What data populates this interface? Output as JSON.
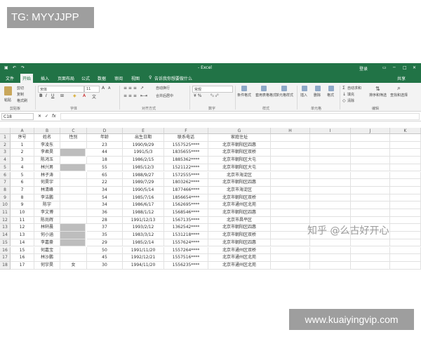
{
  "overlay": {
    "tag": "TG: MYYJJPP",
    "site": "www.kuaiyingvip.com"
  },
  "window": {
    "title": "- Excel",
    "login": "登录"
  },
  "tabs": [
    "文件",
    "开始",
    "插入",
    "页面布局",
    "公式",
    "数据",
    "审阅",
    "视图"
  ],
  "active_tab": 1,
  "tell_me": "告诉我你想要做什么",
  "share": "共享",
  "ribbon": {
    "paste": "粘贴",
    "cut": "剪切",
    "copy": "复制",
    "format_painter": "格式刷",
    "font_name": "宋体",
    "font_size": "11",
    "wrap": "自动换行",
    "merge": "合并后居中",
    "number_format": "常规",
    "cond_format": "条件格式",
    "table_format": "套用表格格式",
    "cell_style": "单元格样式",
    "insert": "插入",
    "delete": "删除",
    "format": "格式",
    "autosum": "自动求和",
    "fill": "填充",
    "clear": "清除",
    "sort_filter": "排序和筛选",
    "find_select": "查找和选择",
    "groups": [
      "剪贴板",
      "字体",
      "对齐方式",
      "数字",
      "样式",
      "单元格",
      "编辑"
    ]
  },
  "formula_bar": {
    "name_box": "C18",
    "fx": "fx"
  },
  "columns": [
    "A",
    "B",
    "C",
    "D",
    "E",
    "F",
    "G",
    "H",
    "I",
    "J",
    "K"
  ],
  "headers": [
    "序号",
    "姓名",
    "性别",
    "年龄",
    "出生日期",
    "联系电话",
    "家庭住址"
  ],
  "rows": [
    [
      "1",
      "李凌东",
      "",
      "23",
      "1990/9/29",
      "1557525****",
      "北京市朝阳区四惠"
    ],
    [
      "2",
      "李君昊",
      "",
      "44",
      "1991/5/3",
      "1835655****",
      "北京市朝阳区双桥"
    ],
    [
      "3",
      "陈鸿玉",
      "",
      "18",
      "1986/2/15",
      "1885362****",
      "北京市朝阳区大屯"
    ],
    [
      "4",
      "林兴男",
      "",
      "55",
      "1985/12/3",
      "1521122****",
      "北京市朝阳区大屯"
    ],
    [
      "5",
      "林子涛",
      "",
      "65",
      "1988/9/27",
      "1572555****",
      "北京市海淀区"
    ],
    [
      "6",
      "何昊宇",
      "",
      "22",
      "1989/7/29",
      "1803262****",
      "北京市朝阳区四惠"
    ],
    [
      "7",
      "林清峰",
      "",
      "34",
      "1990/5/14",
      "1877466****",
      "北京市海淀区"
    ],
    [
      "8",
      "李洁鹏",
      "",
      "54",
      "1985/7/16",
      "1856654****",
      "北京市朝阳区双桥"
    ],
    [
      "9",
      "陈宇",
      "",
      "34",
      "1986/6/17",
      "1562695****",
      "北京市通州区北苑"
    ],
    [
      "10",
      "李文博",
      "",
      "36",
      "1988/1/12",
      "1568546****",
      "北京市朝阳区四惠"
    ],
    [
      "11",
      "陈尚辉",
      "",
      "28",
      "1991/12/13",
      "1567135****",
      "北京市昌平区"
    ],
    [
      "12",
      "林轩晨",
      "",
      "37",
      "1993/2/12",
      "1362542****",
      "北京市朝阳区四惠"
    ],
    [
      "13",
      "何小涵",
      "",
      "35",
      "1983/3/12",
      "1531218****",
      "北京市朝阳区双桥"
    ],
    [
      "14",
      "李嘉豪",
      "",
      "29",
      "1985/2/14",
      "1557624****",
      "北京市朝阳区四惠"
    ],
    [
      "15",
      "何嘉宝",
      "",
      "50",
      "1991/11/20",
      "1557264****",
      "北京市通州区双桥"
    ],
    [
      "16",
      "林沙鹏",
      "",
      "45",
      "1992/12/21",
      "1557516****",
      "北京市通州区北苑"
    ],
    [
      "17",
      "何宇昊",
      "女",
      "30",
      "1994/11/20",
      "1556235****",
      "北京市通州区北苑"
    ]
  ],
  "shaded_gender_rows": [
    1,
    3,
    11,
    12,
    13
  ],
  "watermark": "知乎 @么古好开心"
}
